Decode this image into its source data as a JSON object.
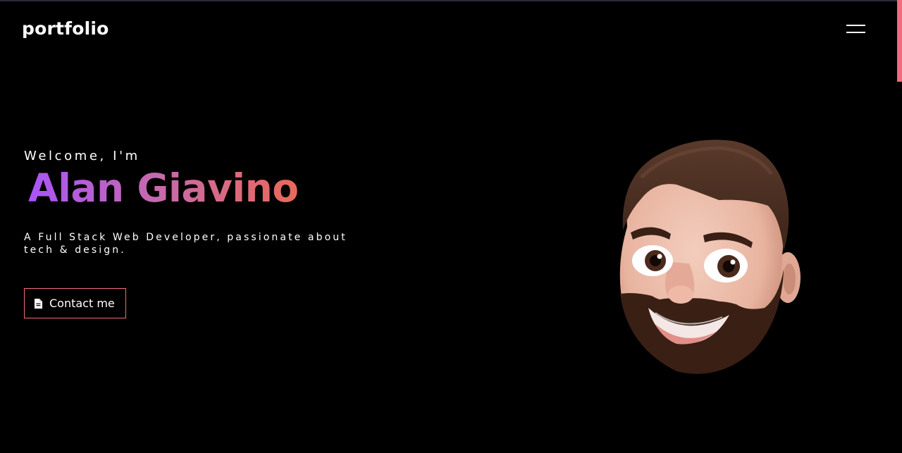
{
  "header": {
    "logo": "portfolio",
    "menu_icon": "hamburger-menu-icon"
  },
  "hero": {
    "greeting": "Welcome, I'm",
    "name": "Alan Giavino",
    "tagline": "A Full Stack Web Developer, passionate about tech & design.",
    "cta_label": "Contact me",
    "cta_icon": "document-icon",
    "avatar": "memoji-avatar"
  },
  "colors": {
    "background": "#000000",
    "accent": "#f26b7e",
    "gradient_start": "#a855f7",
    "gradient_end": "#e9695a"
  }
}
